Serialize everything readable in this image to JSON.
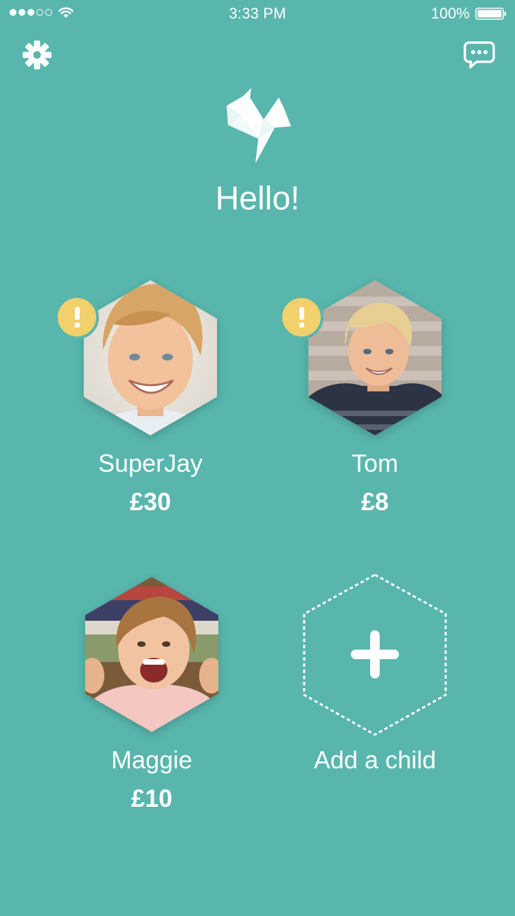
{
  "status_bar": {
    "time": "3:33 PM",
    "battery_percent": "100%",
    "signal_strength": 3,
    "signal_max": 5,
    "battery_level": 1.0
  },
  "header": {
    "settings_icon": "gear-icon",
    "chat_icon": "chat-bubble-icon",
    "logo_icon": "origami-bird-logo"
  },
  "greeting": "Hello!",
  "children": [
    {
      "name": "SuperJay",
      "balance": "£30",
      "has_alert": true
    },
    {
      "name": "Tom",
      "balance": "£8",
      "has_alert": true
    },
    {
      "name": "Maggie",
      "balance": "£10",
      "has_alert": false
    }
  ],
  "add_child": {
    "label": "Add a child",
    "icon": "plus-icon"
  },
  "colors": {
    "background": "#58b6ad",
    "alert": "#f2d06b",
    "text": "#ffffff"
  }
}
